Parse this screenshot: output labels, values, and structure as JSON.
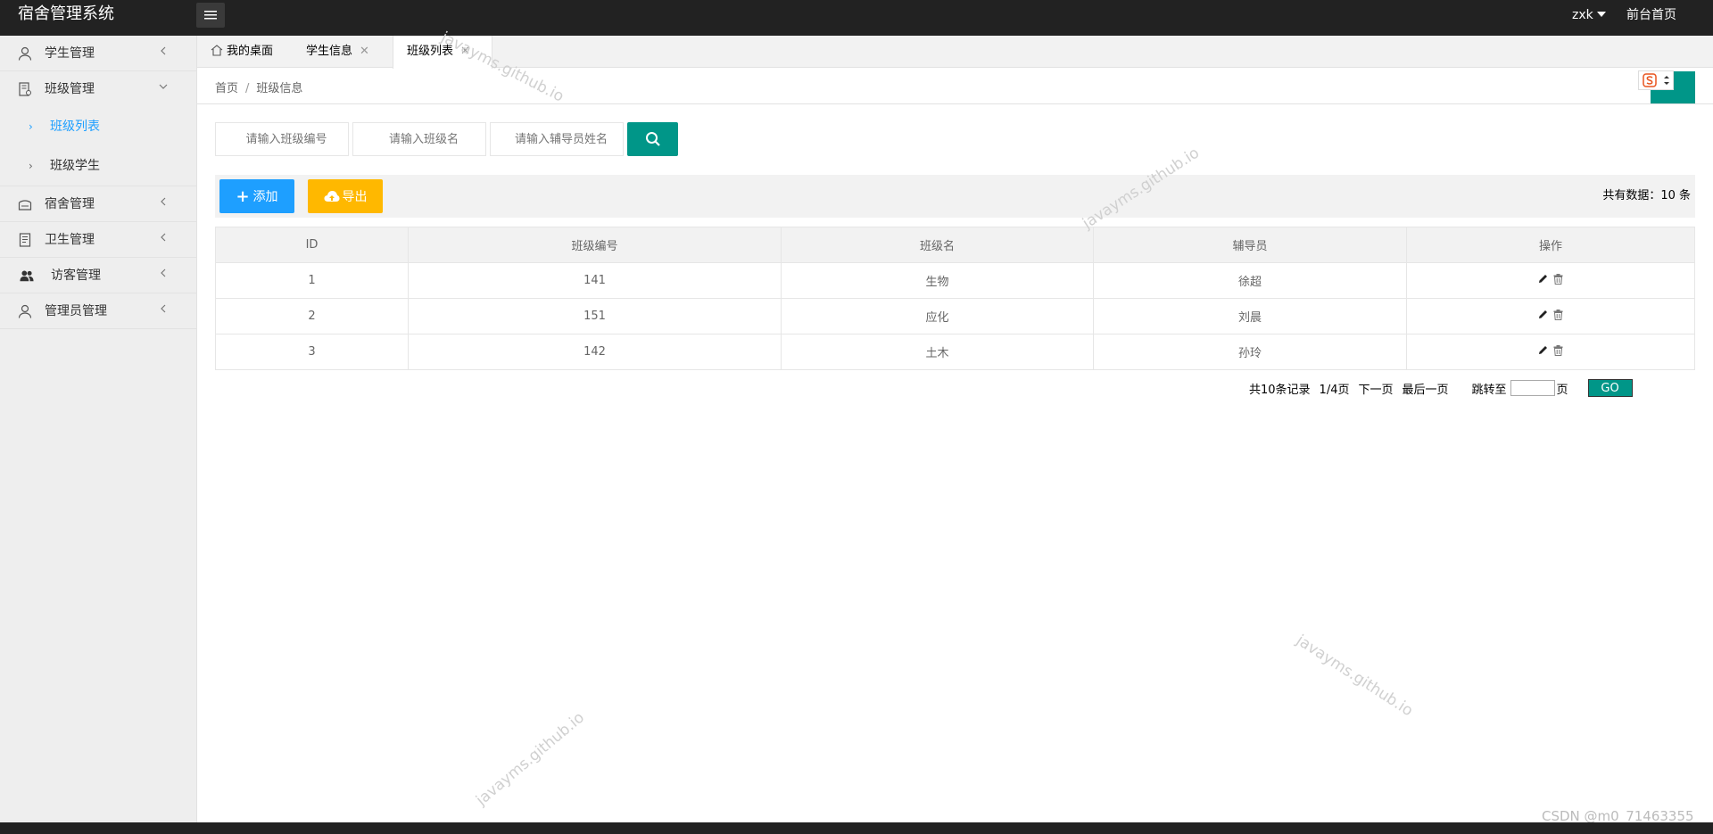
{
  "app": {
    "title": "宿舍管理系统"
  },
  "header": {
    "user": "zxk",
    "front_link": "前台首页"
  },
  "sidebar": {
    "items": [
      {
        "label": "学生管理",
        "icon": "user-icon"
      },
      {
        "label": "班级管理",
        "icon": "class-icon",
        "expanded": true,
        "children": [
          {
            "label": "班级列表",
            "active": true
          },
          {
            "label": "班级学生"
          }
        ]
      },
      {
        "label": "宿舍管理",
        "icon": "dorm-icon"
      },
      {
        "label": "卫生管理",
        "icon": "hygiene-icon"
      },
      {
        "label": "访客管理",
        "icon": "visitors-icon"
      },
      {
        "label": "管理员管理",
        "icon": "admin-icon"
      }
    ]
  },
  "tabs": [
    {
      "label": "我的桌面",
      "icon": "home-icon"
    },
    {
      "label": "学生信息",
      "closable": true
    },
    {
      "label": "班级列表",
      "closable": true,
      "active": true
    }
  ],
  "breadcrumb": {
    "home": "首页",
    "separator": "/",
    "current": "班级信息"
  },
  "search": {
    "class_no_placeholder": "请输入班级编号",
    "class_name_placeholder": "请输入班级名",
    "counselor_placeholder": "请输入辅导员姓名"
  },
  "toolbar": {
    "add_label": "添加",
    "export_label": "导出",
    "total_text": "共有数据：10 条"
  },
  "table": {
    "headers": [
      "ID",
      "班级编号",
      "班级名",
      "辅导员",
      "操作"
    ],
    "rows": [
      [
        "1",
        "141",
        "生物",
        "徐超"
      ],
      [
        "2",
        "151",
        "应化",
        "刘晨"
      ],
      [
        "3",
        "142",
        "土木",
        "孙玲"
      ]
    ]
  },
  "pager": {
    "total_records": "共10条记录",
    "page_info": "1/4页",
    "next": "下一页",
    "last": "最后一页",
    "jump_label": "跳转至",
    "page_suffix": "页",
    "go": "GO"
  },
  "watermark": "javayms.github.io",
  "csdn_mark": "CSDN @m0_71463355",
  "colors": {
    "primary": "#009688",
    "blue": "#1e9fff",
    "orange": "#ffb800",
    "header": "#222222"
  }
}
